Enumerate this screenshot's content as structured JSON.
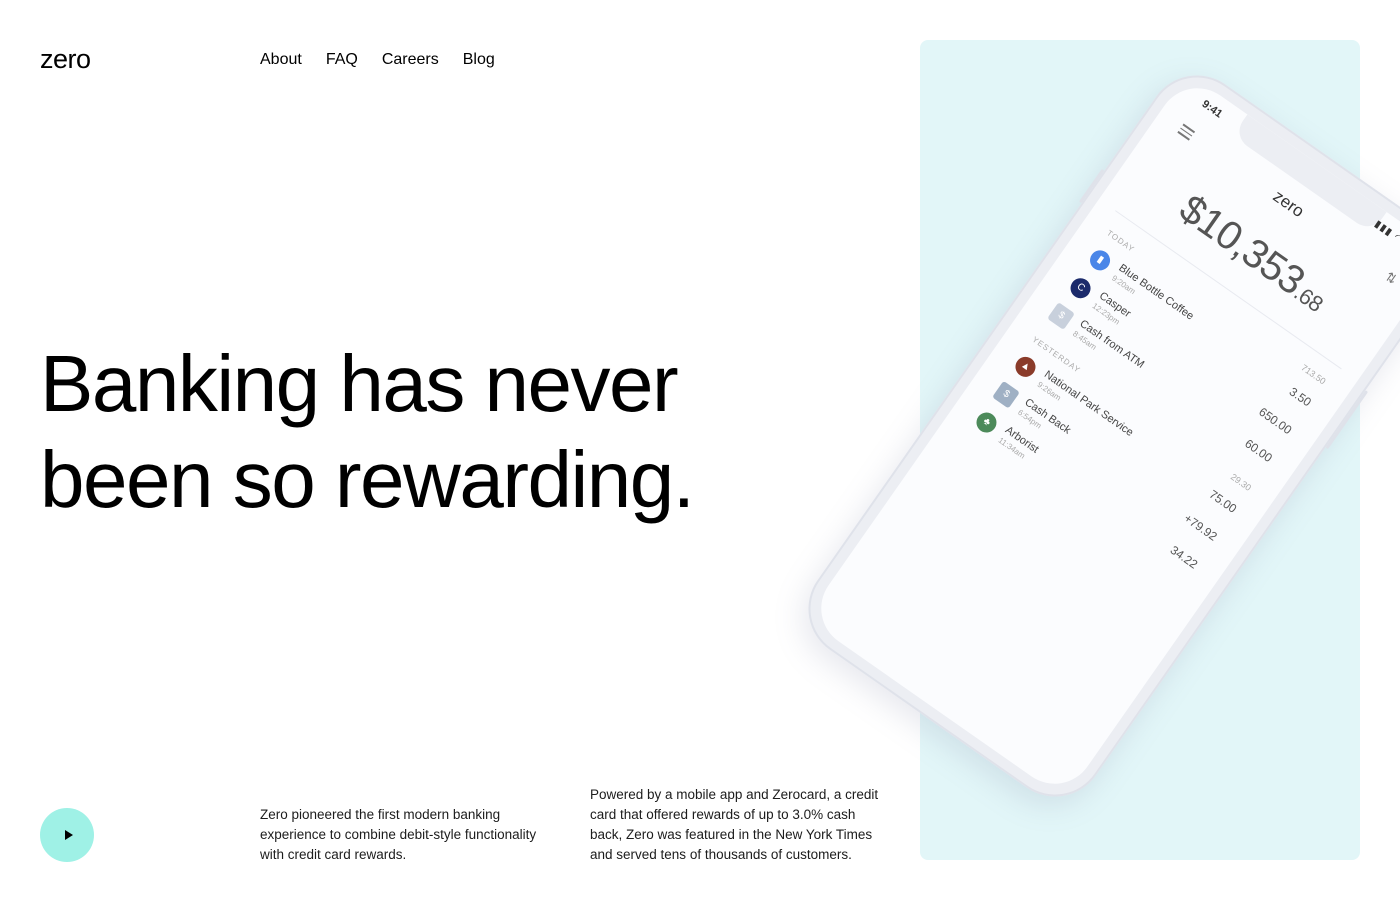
{
  "brand": {
    "logo": "zero"
  },
  "nav": {
    "items": [
      "About",
      "FAQ",
      "Careers",
      "Blog"
    ]
  },
  "hero": {
    "headline_line1": "Banking has never",
    "headline_line2": "been so rewarding."
  },
  "play_button": {
    "icon": "play-icon",
    "color": "#9ff1e6"
  },
  "paragraphs": [
    "Zero pioneered the first modern banking experience to combine debit-style functionality with credit card rewards.",
    "Powered by a mobile app and Zerocard, a credit card that offered rewards of up to 3.0% cash back, Zero was featured in the New York Times and served tens of thousands of customers."
  ],
  "panel": {
    "background": "#e2f6f8"
  },
  "phone": {
    "time": "9:41",
    "app_logo": "zero",
    "balance_main": "$10,353",
    "balance_cents": ".68",
    "section_today": "TODAY",
    "section_yesterday": "YESTERDAY",
    "today": [
      {
        "name": "Blue Bottle Coffee",
        "time": "9:20am",
        "amount": "3.50",
        "icon": "coffee-icon",
        "icon_color": "#4a86e8"
      },
      {
        "name": "Casper",
        "time": "12:23pm",
        "amount": "650.00",
        "icon": "casper-icon",
        "icon_color": "#1b2a6b"
      },
      {
        "name": "Cash from ATM",
        "time": "8:45am",
        "amount": "60.00",
        "icon": "atm-icon",
        "icon_color": "#c8d0dc"
      }
    ],
    "today_total": "713.50",
    "yesterday": [
      {
        "name": "National Park Service",
        "time": "9:26am",
        "amount": "75.00",
        "icon": "park-icon",
        "icon_color": "#8a3b2a"
      },
      {
        "name": "Cash Back",
        "time": "6:54pm",
        "amount": "+79.92",
        "icon": "cashback-icon",
        "icon_color": "#9fb0c4"
      },
      {
        "name": "Arborist",
        "time": "11:34am",
        "amount": "34.22",
        "icon": "arborist-icon",
        "icon_color": "#4c8a5a"
      }
    ],
    "yesterday_total": "29.30"
  }
}
